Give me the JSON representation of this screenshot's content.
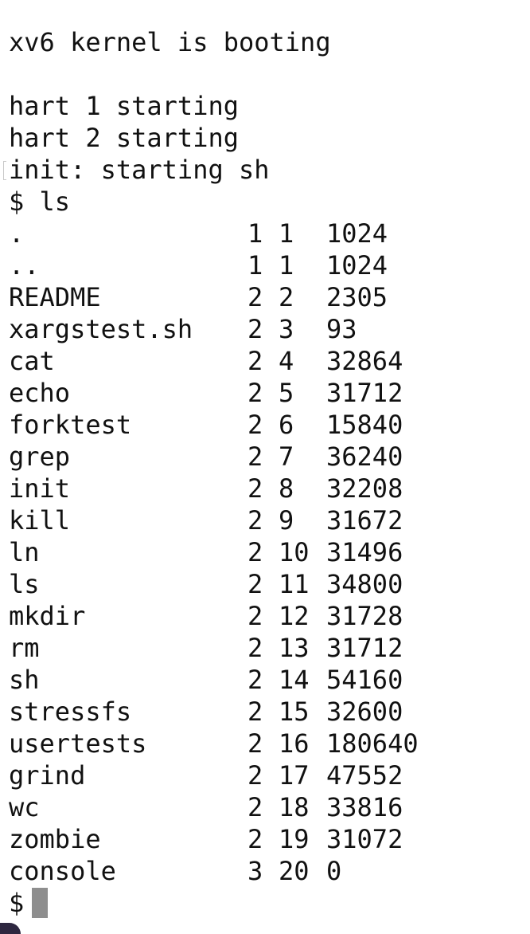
{
  "terminal": {
    "boot_line": "xv6 kernel is booting",
    "hart1": "hart 1 starting",
    "hart2": "hart 2 starting",
    "init": "init: starting sh",
    "command": "$ ls",
    "prompt": "$",
    "cursor_color": "#8e8e8e",
    "text_color": "#111111",
    "background": "#ffffff"
  },
  "listing": [
    {
      "name": ".",
      "type": "1",
      "ino": "1",
      "size": "1024"
    },
    {
      "name": "..",
      "type": "1",
      "ino": "1",
      "size": "1024"
    },
    {
      "name": "README",
      "type": "2",
      "ino": "2",
      "size": "2305"
    },
    {
      "name": "xargstest.sh",
      "type": "2",
      "ino": "3",
      "size": "93"
    },
    {
      "name": "cat",
      "type": "2",
      "ino": "4",
      "size": "32864"
    },
    {
      "name": "echo",
      "type": "2",
      "ino": "5",
      "size": "31712"
    },
    {
      "name": "forktest",
      "type": "2",
      "ino": "6",
      "size": "15840"
    },
    {
      "name": "grep",
      "type": "2",
      "ino": "7",
      "size": "36240"
    },
    {
      "name": "init",
      "type": "2",
      "ino": "8",
      "size": "32208"
    },
    {
      "name": "kill",
      "type": "2",
      "ino": "9",
      "size": "31672"
    },
    {
      "name": "ln",
      "type": "2",
      "ino": "10",
      "size": "31496"
    },
    {
      "name": "ls",
      "type": "2",
      "ino": "11",
      "size": "34800"
    },
    {
      "name": "mkdir",
      "type": "2",
      "ino": "12",
      "size": "31728"
    },
    {
      "name": "rm",
      "type": "2",
      "ino": "13",
      "size": "31712"
    },
    {
      "name": "sh",
      "type": "2",
      "ino": "14",
      "size": "54160"
    },
    {
      "name": "stressfs",
      "type": "2",
      "ino": "15",
      "size": "32600"
    },
    {
      "name": "usertests",
      "type": "2",
      "ino": "16",
      "size": "180640"
    },
    {
      "name": "grind",
      "type": "2",
      "ino": "17",
      "size": "47552"
    },
    {
      "name": "wc",
      "type": "2",
      "ino": "18",
      "size": "33816"
    },
    {
      "name": "zombie",
      "type": "2",
      "ino": "19",
      "size": "31072"
    },
    {
      "name": "console",
      "type": "3",
      "ino": "20",
      "size": "0"
    }
  ]
}
